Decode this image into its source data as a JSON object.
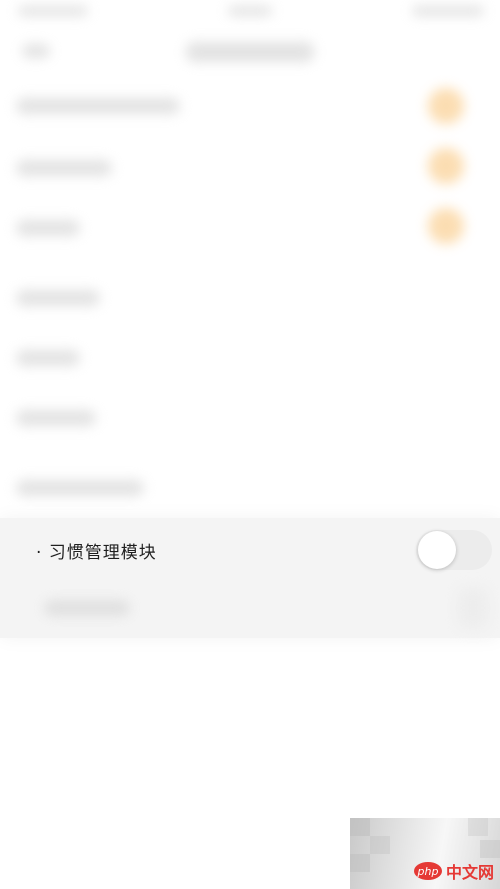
{
  "habit_module": {
    "label": "· 习惯管理模块",
    "toggle_on": false
  },
  "watermark": {
    "logo": "php",
    "text": "中文网"
  },
  "colors": {
    "badge": "#fbd59f",
    "panel": "#f4f4f4",
    "watermark_red": "#e53935"
  }
}
